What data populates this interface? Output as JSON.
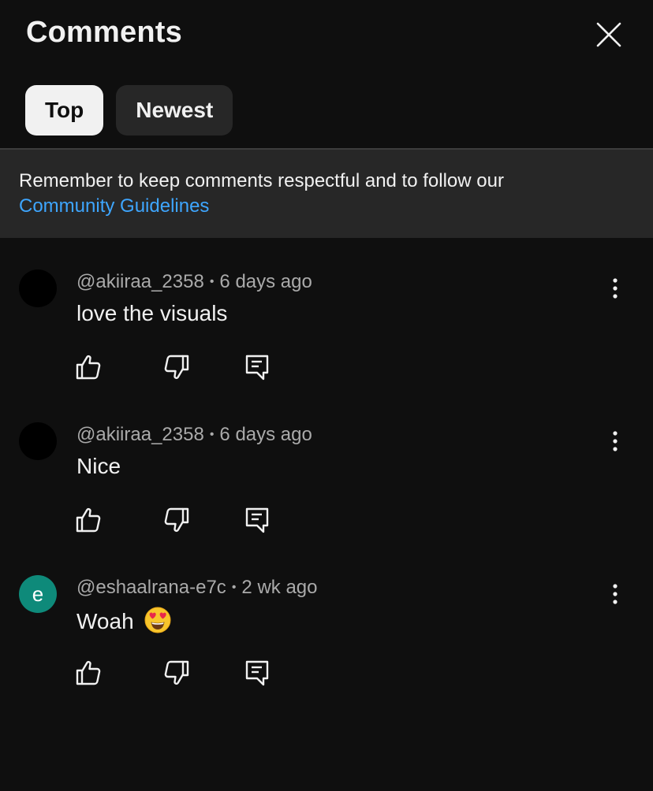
{
  "header": {
    "title": "Comments",
    "close_icon": "close-icon"
  },
  "filters": [
    {
      "label": "Top",
      "selected": true
    },
    {
      "label": "Newest",
      "selected": false
    }
  ],
  "notice": {
    "text": "Remember to keep comments respectful and to follow our",
    "link": "Community Guidelines"
  },
  "comments": [
    {
      "author": "@akiiraa_2358",
      "separator": "•",
      "time": "6 days ago",
      "text": "love the visuals",
      "avatar_letter": "",
      "avatar_color": "#000000"
    },
    {
      "author": "@akiiraa_2358",
      "separator": "•",
      "time": "6 days ago",
      "text": "Nice",
      "avatar_letter": "",
      "avatar_color": "#000000"
    },
    {
      "author": "@eshaalrana-e7c",
      "separator": "•",
      "time": "2 wk ago",
      "text": "Woah",
      "emoji": "heart-eyes-emoji",
      "avatar_letter": "e",
      "avatar_color": "#0e8a7a"
    }
  ],
  "colors": {
    "background": "#0f0f0f",
    "notice_bg": "#272727",
    "link": "#3ea6ff",
    "secondary_text": "#aaaaaa"
  }
}
